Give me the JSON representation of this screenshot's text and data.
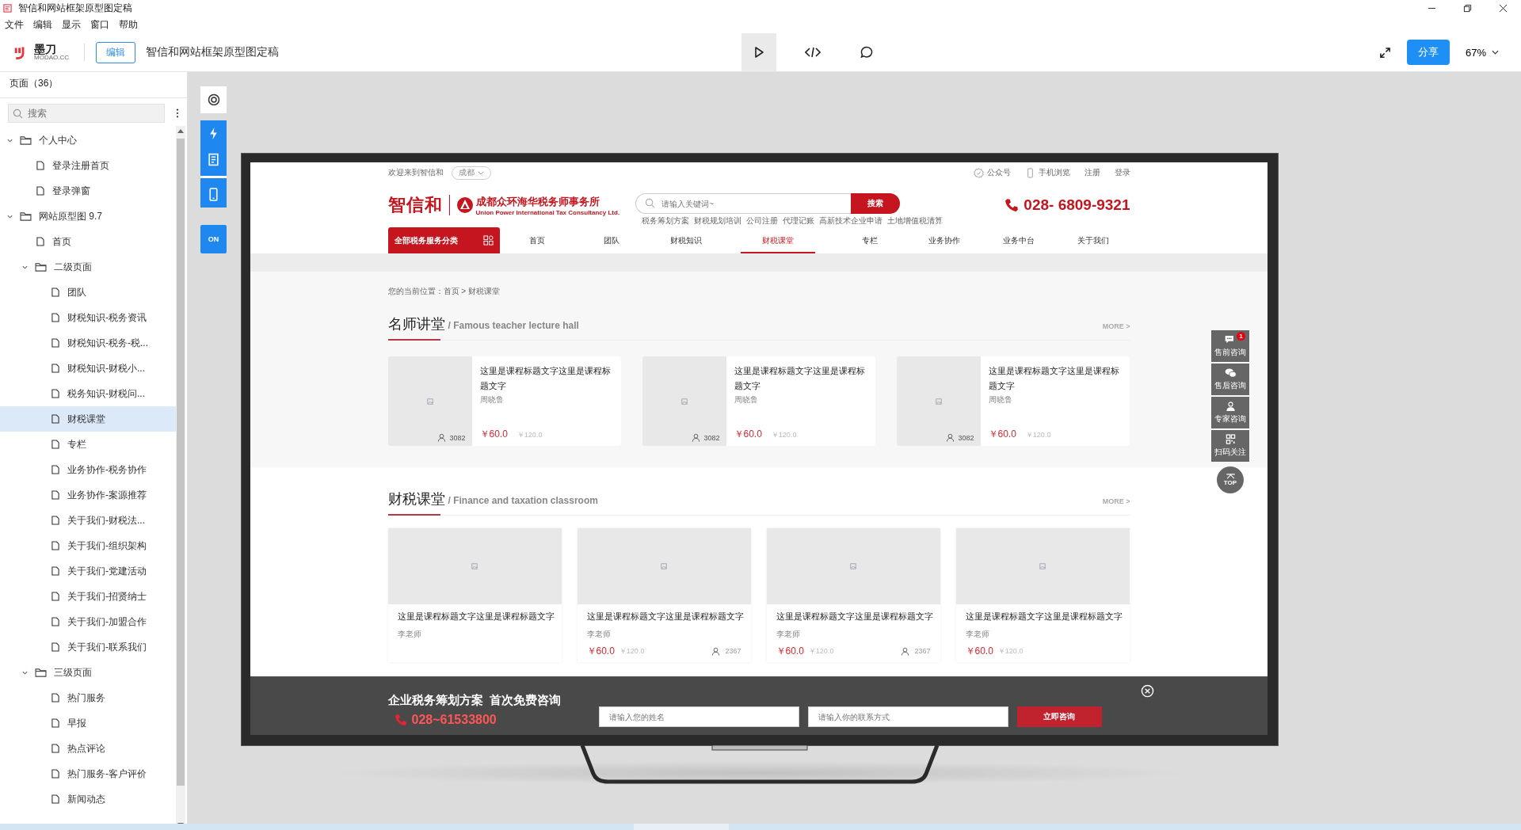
{
  "window": {
    "title": "智信和网站框架原型图定稿"
  },
  "menu": [
    "文件",
    "编辑",
    "显示",
    "窗口",
    "帮助"
  ],
  "toolbar": {
    "logo": "墨刀",
    "logo_sub": "MODAO.CC",
    "edit_button": "编辑",
    "doc_title": "智信和网站框架原型图定稿",
    "share_button": "分享",
    "zoom": "67%"
  },
  "pages_panel": {
    "title": "页面（36）",
    "search_placeholder": "搜索",
    "tree": [
      {
        "label": "个人中心",
        "kind": "folder",
        "expanded": true,
        "selected": false,
        "children": [
          {
            "label": "登录注册首页",
            "kind": "page",
            "selected": false
          },
          {
            "label": "登录弹窗",
            "kind": "page",
            "selected": false
          }
        ]
      },
      {
        "label": "网站原型图 9.7",
        "kind": "folder",
        "expanded": true,
        "selected": false,
        "children": [
          {
            "label": "首页",
            "kind": "page",
            "selected": false
          },
          {
            "label": "二级页面",
            "kind": "folder",
            "expanded": true,
            "selected": false,
            "children": [
              {
                "label": "团队",
                "kind": "page",
                "selected": false
              },
              {
                "label": "财税知识-税务资讯",
                "kind": "page",
                "selected": false
              },
              {
                "label": "财税知识-税务-税...",
                "kind": "page",
                "selected": false
              },
              {
                "label": "财税知识-财税小...",
                "kind": "page",
                "selected": false
              },
              {
                "label": "税务知识-财税问...",
                "kind": "page",
                "selected": false
              },
              {
                "label": "财税课堂",
                "kind": "page",
                "selected": true
              },
              {
                "label": "专栏",
                "kind": "page",
                "selected": false
              },
              {
                "label": "业务协作-税务协作",
                "kind": "page",
                "selected": false
              },
              {
                "label": "业务协作-案源推荐",
                "kind": "page",
                "selected": false
              },
              {
                "label": "关于我们-财税法...",
                "kind": "page",
                "selected": false
              },
              {
                "label": "关于我们-组织架构",
                "kind": "page",
                "selected": false
              },
              {
                "label": "关于我们-党建活动",
                "kind": "page",
                "selected": false
              },
              {
                "label": "关于我们-招贤纳士",
                "kind": "page",
                "selected": false
              },
              {
                "label": "关于我们-加盟合作",
                "kind": "page",
                "selected": false
              },
              {
                "label": "关于我们-联系我们",
                "kind": "page",
                "selected": false
              }
            ]
          },
          {
            "label": "三级页面",
            "kind": "folder",
            "expanded": true,
            "selected": false,
            "children": [
              {
                "label": "热门服务",
                "kind": "page",
                "selected": false
              },
              {
                "label": "早报",
                "kind": "page",
                "selected": false
              },
              {
                "label": "热点评论",
                "kind": "page",
                "selected": false
              },
              {
                "label": "热门服务-客户评价",
                "kind": "page",
                "selected": false
              },
              {
                "label": "新闻动态",
                "kind": "page",
                "selected": false
              }
            ]
          }
        ]
      }
    ]
  },
  "canvas_tools": {
    "toggle_label": "ON"
  },
  "site": {
    "greeting": "欢迎来到智信和",
    "city": "成都",
    "top_links": [
      {
        "label": "公众号",
        "kind": "wechat"
      },
      {
        "label": "手机浏览",
        "kind": "phone"
      },
      {
        "label": "注册",
        "kind": "text"
      },
      {
        "label": "登录",
        "kind": "text"
      }
    ],
    "logo": "智信和",
    "firm_name": "成都众环海华税务师事务所",
    "firm_name_en": "Union Power International Tax Consultancy Ltd.",
    "search": {
      "placeholder": "请输入关键词~",
      "button": "搜索"
    },
    "hot_keywords": [
      "税务筹划方案",
      "财税规划培训",
      "公司注册",
      "代理记账",
      "高新技术企业申请",
      "土地增值税清算"
    ],
    "hotline": "028- 6809-9321",
    "category_button": "全部税务服务分类",
    "nav": [
      {
        "label": "首页",
        "selected": false
      },
      {
        "label": "团队",
        "selected": false
      },
      {
        "label": "财税知识",
        "selected": false
      },
      {
        "label": "财税课堂",
        "selected": true
      },
      {
        "label": "专栏",
        "selected": false
      },
      {
        "label": "业务协作",
        "selected": false
      },
      {
        "label": "业务中台",
        "selected": false
      },
      {
        "label": "关于我们",
        "selected": false
      }
    ],
    "breadcrumb": "您的当前位置：首页 > 财税课堂",
    "featured": {
      "title": "名师讲堂",
      "subtitle": "/ Famous teacher lecture hall",
      "more": "MORE >",
      "courses": [
        {
          "title": "这里是课程标题文字这里是课程标题文字",
          "teacher": "周晓鲁",
          "students": "3082",
          "price": "￥60.0",
          "original_price": "￥120.0"
        },
        {
          "title": "这里是课程标题文字这里是课程标题文字",
          "teacher": "周晓鲁",
          "students": "3082",
          "price": "￥60.0",
          "original_price": "￥120.0"
        },
        {
          "title": "这里是课程标题文字这里是课程标题文字",
          "teacher": "周晓鲁",
          "students": "3082",
          "price": "￥60.0",
          "original_price": "￥120.0"
        }
      ]
    },
    "classroom": {
      "title": "财税课堂",
      "subtitle": "/ Finance and taxation classroom",
      "more": "MORE >",
      "courses": [
        {
          "title": "这里是课程标题文字这里是课程标题文字",
          "teacher": "李老师"
        },
        {
          "title": "这里是课程标题文字这里是课程标题文字",
          "teacher": "李老师",
          "price": "￥60.0",
          "original_price": "￥120.0",
          "students": "2367"
        },
        {
          "title": "这里是课程标题文字这里是课程标题文字",
          "teacher": "李老师",
          "price": "￥60.0",
          "original_price": "￥120.0",
          "students": "2367"
        },
        {
          "title": "这里是课程标题文字这里是课程标题文字",
          "teacher": "李老师",
          "price": "￥60.0",
          "original_price": "￥120.0"
        }
      ]
    },
    "side_tools": [
      {
        "label": "售前咨询",
        "kind": "chat",
        "badge": "1"
      },
      {
        "label": "售后咨询",
        "kind": "wechat"
      },
      {
        "label": "专家咨询",
        "kind": "expert"
      },
      {
        "label": "扫码关注",
        "kind": "qr"
      }
    ],
    "top_button": "TOP",
    "consult_bar": {
      "headline": "企业税务筹划方案  首次免费咨询",
      "phone": "028~61533800",
      "name_placeholder": "请输入您的姓名",
      "contact_placeholder": "请输入你的联系方式",
      "submit": "立即咨询"
    }
  }
}
